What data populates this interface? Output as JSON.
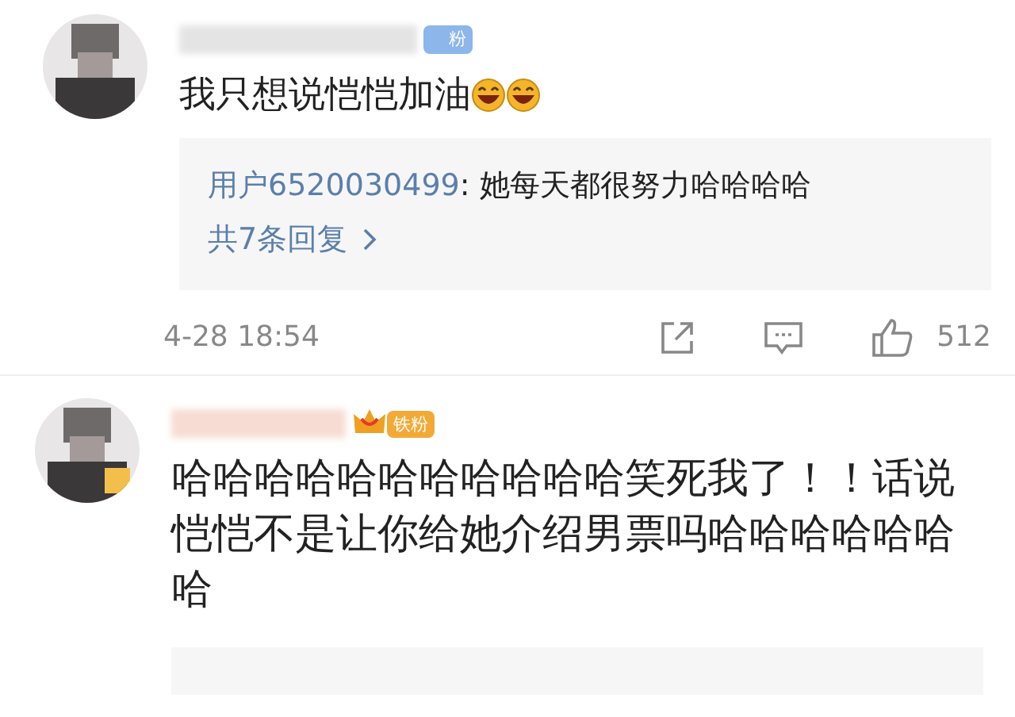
{
  "comments": [
    {
      "badge": {
        "kind": "plain",
        "label": "粉"
      },
      "text": "我只想说恺恺加油",
      "emojis": [
        {
          "kind": "laughing"
        },
        {
          "kind": "laughing"
        }
      ],
      "replies": {
        "kind": "preview",
        "author": "用户6520030499",
        "text": ": 她每天都很努力哈哈哈哈",
        "more": "共7条回复"
      },
      "time": "4-28 18:54",
      "likes": "512"
    },
    {
      "badge": {
        "kind": "crown",
        "label": "铁粉"
      },
      "text": "哈哈哈哈哈哈哈哈哈哈哈笑死我了！！话说恺恺不是让你给她介绍男票吗哈哈哈哈哈哈哈",
      "replies": {
        "kind": "cut"
      }
    }
  ]
}
